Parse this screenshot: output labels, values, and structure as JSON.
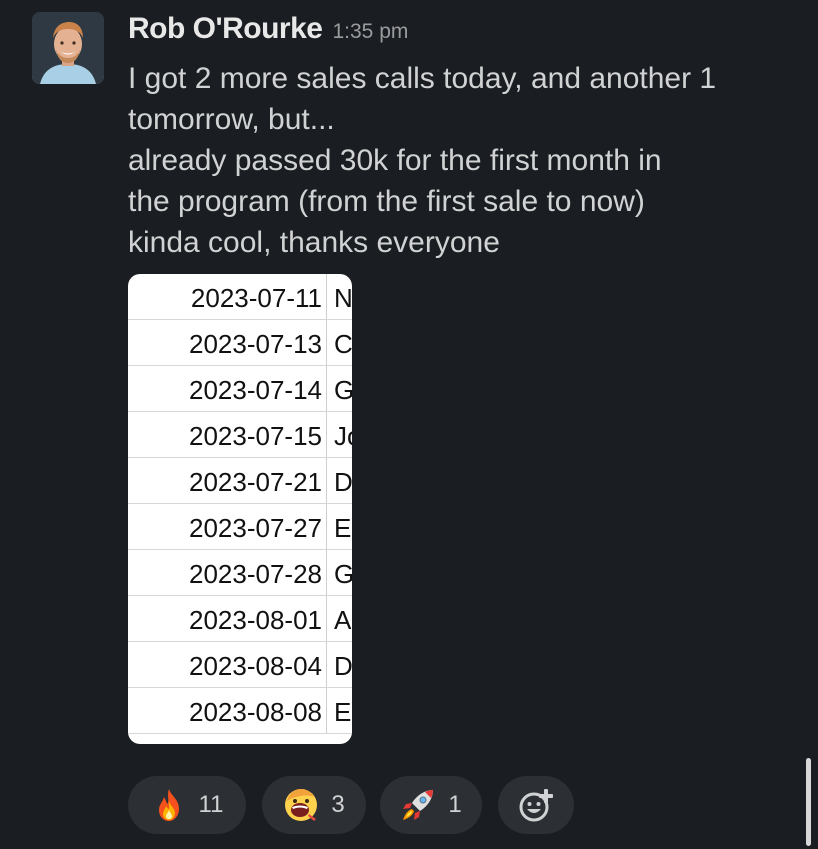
{
  "message": {
    "author": "Rob O'Rourke",
    "time": "1:35 pm",
    "lines": [
      "I got 2 more sales calls today, and another 1",
      "tomorrow, but...",
      "already passed 30k for the first month in",
      "the program (from the first sale to now)",
      "kinda cool, thanks everyone"
    ]
  },
  "attachment": {
    "rows": [
      {
        "date": "2023-07-11",
        "name": "N"
      },
      {
        "date": "2023-07-13",
        "name": "C"
      },
      {
        "date": "2023-07-14",
        "name": "G"
      },
      {
        "date": "2023-07-15",
        "name": "Jo"
      },
      {
        "date": "2023-07-21",
        "name": "D"
      },
      {
        "date": "2023-07-27",
        "name": "E"
      },
      {
        "date": "2023-07-28",
        "name": "G"
      },
      {
        "date": "2023-08-01",
        "name": "A"
      },
      {
        "date": "2023-08-04",
        "name": "D"
      },
      {
        "date": "2023-08-08",
        "name": "E"
      }
    ]
  },
  "reactions": [
    {
      "icon": "fire-icon",
      "count": "11"
    },
    {
      "icon": "screaming-face-icon",
      "count": "3"
    },
    {
      "icon": "rocket-icon",
      "count": "1"
    }
  ],
  "add_reaction": {
    "icon": "add-reaction-icon"
  },
  "colors": {
    "background": "#1a1d21",
    "reaction_pill": "#2c2f33",
    "text": "#d1d2d3",
    "author": "#e8e8e8",
    "timestamp": "#9a9b9d"
  }
}
